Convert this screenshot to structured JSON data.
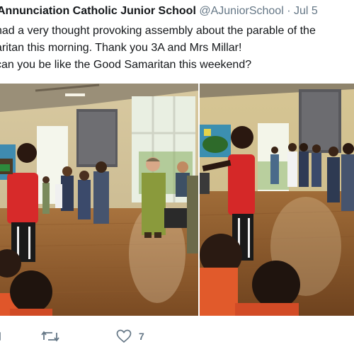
{
  "tweet": {
    "author_name": "Annunciation Catholic Junior School",
    "handle": "@AJuniorSchool",
    "separator": "·",
    "date": "Jul 5",
    "lines": [
      "had a very thought provoking assembly about the parable of the",
      "aritan this morning. Thank you 3A and Mrs Millar!",
      " can you be like the Good Samaritan this weekend?"
    ]
  },
  "media": {
    "left_photo": "assembly-photo-left",
    "right_photo": "assembly-photo-right"
  },
  "actions": {
    "reply_icon": "reply-icon",
    "retweet_icon": "retweet-icon",
    "like_icon": "heart-icon",
    "like_count": "7",
    "colors": {
      "muted": "#657786",
      "text": "#14171a"
    }
  }
}
